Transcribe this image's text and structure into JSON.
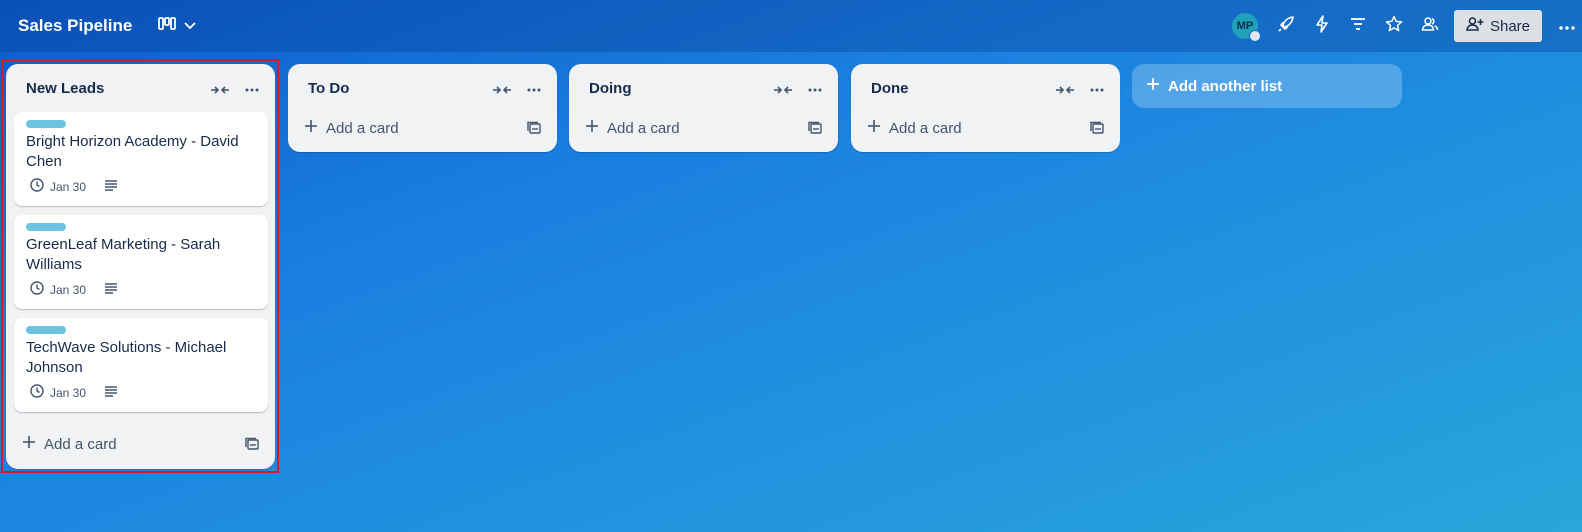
{
  "board": {
    "title": "Sales Pipeline"
  },
  "topbar": {
    "avatar_initials": "MP",
    "share_label": "Share",
    "icons": [
      "board-view-icon",
      "chevron-down-icon",
      "power-ups-icon",
      "automation-icon",
      "filter-icon",
      "star-icon",
      "visibility-icon",
      "add-member-icon",
      "more-icon"
    ]
  },
  "lists": [
    {
      "title": "New Leads",
      "cards": [
        {
          "title": "Bright Horizon Academy - David Chen",
          "due": "Jan 30",
          "label_color": "#6cc3e0"
        },
        {
          "title": "GreenLeaf Marketing - Sarah Williams",
          "due": "Jan 30",
          "label_color": "#6cc3e0"
        },
        {
          "title": "TechWave Solutions - Michael Johnson",
          "due": "Jan 30",
          "label_color": "#6cc3e0"
        }
      ],
      "add_card_label": "Add a card"
    },
    {
      "title": "To Do",
      "cards": [],
      "add_card_label": "Add a card"
    },
    {
      "title": "Doing",
      "cards": [],
      "add_card_label": "Add a card"
    },
    {
      "title": "Done",
      "cards": [],
      "add_card_label": "Add a card"
    }
  ],
  "add_list_label": "Add another list",
  "colors": {
    "highlight": "#d11a2a",
    "card_label": "#6cc3e0",
    "list_bg": "#f1f2f4"
  }
}
